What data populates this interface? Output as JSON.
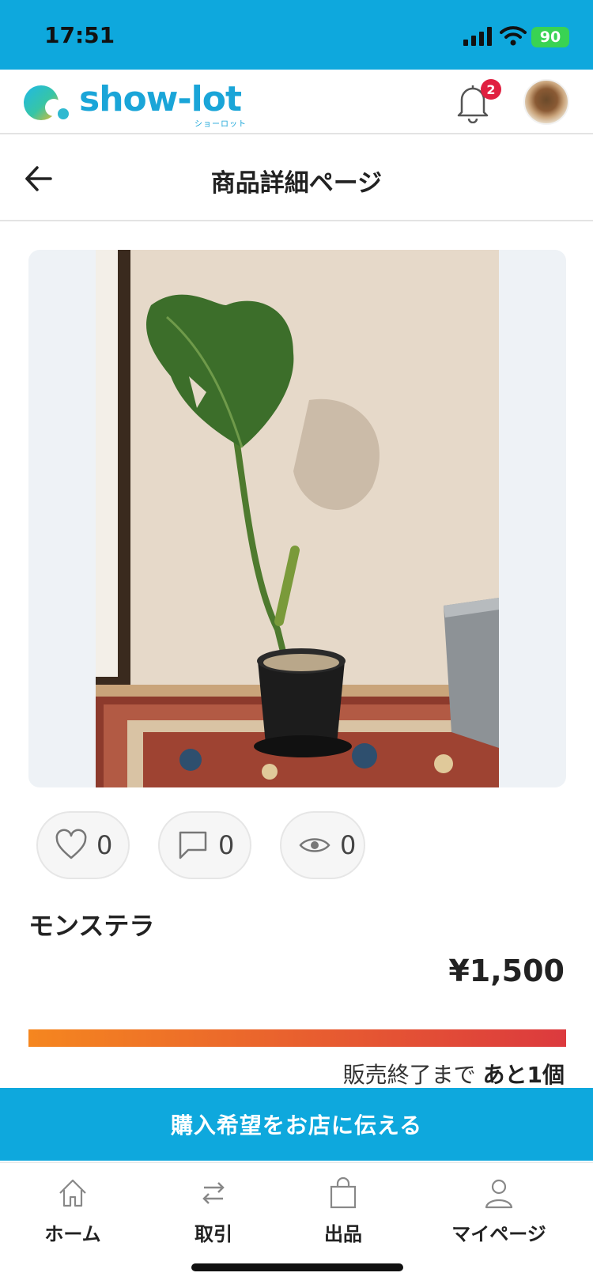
{
  "status_bar": {
    "time": "17:51",
    "battery": "90"
  },
  "header": {
    "logo_text": "show-lot",
    "logo_sub": "ショーロット",
    "notification_count": "2",
    "colors": {
      "brand": "#0ea8dd",
      "badge": "#e02040"
    }
  },
  "page": {
    "title": "商品詳細ページ"
  },
  "stats": {
    "likes": "0",
    "comments": "0",
    "views": "0"
  },
  "product": {
    "name": "モンステラ",
    "price": "¥1,500",
    "stock_label": "販売終了まで",
    "stock_remaining": "あと1個"
  },
  "cta": {
    "label": "購入希望をお店に伝える"
  },
  "tabs": [
    {
      "label": "ホーム",
      "icon": "home-icon"
    },
    {
      "label": "取引",
      "icon": "swap-arrows-icon"
    },
    {
      "label": "出品",
      "icon": "shopping-bag-icon"
    },
    {
      "label": "マイページ",
      "icon": "person-icon"
    }
  ]
}
